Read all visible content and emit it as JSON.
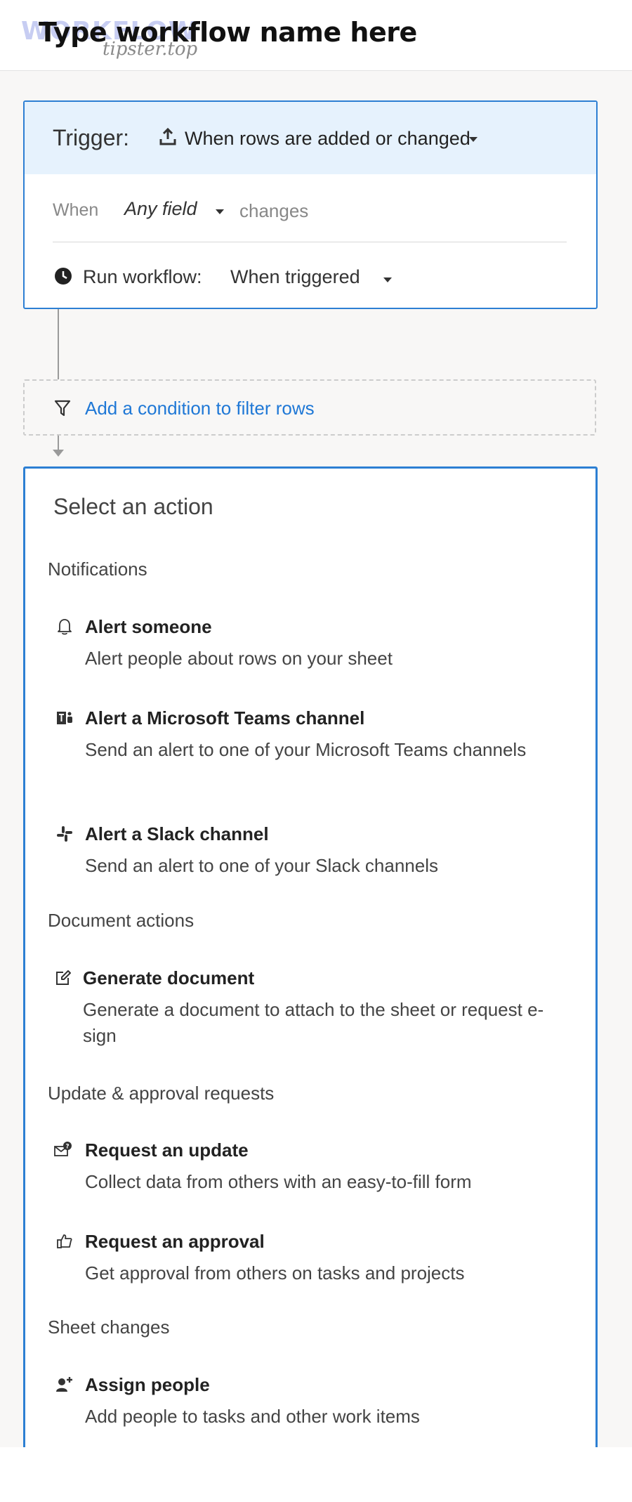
{
  "header": {
    "watermark_logo": "WORKFLOW",
    "workflow_name": "Type workflow name here",
    "watermark_sub": "tipster.top"
  },
  "trigger": {
    "label": "Trigger:",
    "value": "When rows are added or changed",
    "when_label": "When",
    "field_value": "Any field",
    "changes_label": "changes",
    "run_label": "Run workflow:",
    "run_value": "When triggered"
  },
  "condition": {
    "link_text": "Add a condition to filter rows"
  },
  "action_panel": {
    "title": "Select an action",
    "sections": [
      {
        "label": "Notifications",
        "items": [
          {
            "name": "Alert someone",
            "desc": "Alert people about rows on your sheet",
            "icon": "bell-icon"
          },
          {
            "name": "Alert a Microsoft Teams channel",
            "desc": "Send an alert to one of your Microsoft Teams channels",
            "icon": "teams-icon"
          },
          {
            "name": "Alert a Slack channel",
            "desc": "Send an alert to one of your Slack channels",
            "icon": "slack-icon"
          }
        ]
      },
      {
        "label": "Document actions",
        "items": [
          {
            "name": "Generate document",
            "desc": "Generate a document to attach to the sheet or request e-sign",
            "icon": "edit-document-icon"
          }
        ]
      },
      {
        "label": "Update & approval requests",
        "items": [
          {
            "name": "Request an update",
            "desc": "Collect data from others with an easy-to-fill form",
            "icon": "mail-question-icon"
          },
          {
            "name": "Request an approval",
            "desc": "Get approval from others on tasks and projects",
            "icon": "thumbs-up-icon"
          }
        ]
      },
      {
        "label": "Sheet changes",
        "items": [
          {
            "name": "Assign people",
            "desc": "Add people to tasks and other work items",
            "icon": "assign-person-icon"
          }
        ]
      }
    ]
  },
  "colors": {
    "accent": "#2d7fd3",
    "link": "#1f78d6",
    "trigger_bg": "#e6f2fd",
    "page_bg": "#f8f7f6"
  }
}
